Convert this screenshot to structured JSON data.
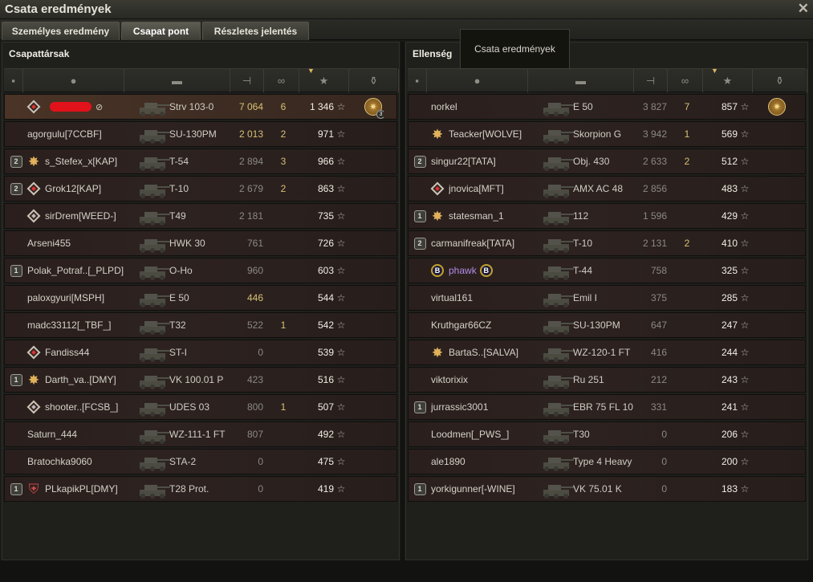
{
  "window": {
    "title": "Csata eredmények",
    "tooltip": "Csata eredmények"
  },
  "tabs": [
    {
      "label": "Személyes eredmény",
      "active": false
    },
    {
      "label": "Csapat pont",
      "active": true
    },
    {
      "label": "Részletes jelentés",
      "active": false
    }
  ],
  "columns": [
    "rank-icon",
    "player-icon",
    "vehicle-icon",
    "damage-icon",
    "frags-icon",
    "xp-icon",
    "achievement-icon"
  ],
  "allies": {
    "title": "Csapattársak",
    "rows": [
      {
        "badge": "",
        "mark": "diamond",
        "player": "",
        "redacted": true,
        "vehicle": "Strv 103-0",
        "damage": "7 064",
        "frags": "6",
        "xp": "1 346",
        "me": true,
        "medal": "3",
        "dmg_hi": true
      },
      {
        "badge": "",
        "mark": "",
        "player": "agorgulu[7CCBF]",
        "vehicle": "SU-130PM",
        "damage": "2 013",
        "frags": "2",
        "xp": "971",
        "dmg_hi": true
      },
      {
        "badge": "2",
        "mark": "sun",
        "player": "s_Stefex_x[KAP]",
        "vehicle": "T-54",
        "damage": "2 894",
        "frags": "3",
        "xp": "966"
      },
      {
        "badge": "2",
        "mark": "diamond",
        "player": "Grok12[KAP]",
        "vehicle": "T-10",
        "damage": "2 679",
        "frags": "2",
        "xp": "863"
      },
      {
        "badge": "",
        "mark": "diamond2",
        "player": "sirDrem[WEED-]",
        "vehicle": "T49",
        "damage": "2 181",
        "frags": "",
        "xp": "735"
      },
      {
        "badge": "",
        "mark": "",
        "player": "Arseni455",
        "vehicle": "HWK 30",
        "damage": "761",
        "frags": "",
        "xp": "726"
      },
      {
        "badge": "1",
        "mark": "",
        "player": "Polak_Potraf..[_PLPD]",
        "vehicle": "O-Ho",
        "damage": "960",
        "frags": "",
        "xp": "603"
      },
      {
        "badge": "",
        "mark": "",
        "player": "paloxgyuri[MSPH]",
        "vehicle": "E 50",
        "damage": "446",
        "frags": "",
        "xp": "544",
        "dmg_hi": true
      },
      {
        "badge": "",
        "mark": "",
        "player": "madc33112[_TBF_]",
        "vehicle": "T32",
        "damage": "522",
        "frags": "1",
        "xp": "542"
      },
      {
        "badge": "",
        "mark": "diamond",
        "player": "Fandiss44",
        "vehicle": "ST-I",
        "damage": "0",
        "frags": "",
        "xp": "539"
      },
      {
        "badge": "1",
        "mark": "sun",
        "player": "Darth_va..[DMY]",
        "vehicle": "VK 100.01 P",
        "damage": "423",
        "frags": "",
        "xp": "516"
      },
      {
        "badge": "",
        "mark": "diamond2",
        "player": "shooter..[FCSB_]",
        "vehicle": "UDES 03",
        "damage": "800",
        "frags": "1",
        "xp": "507"
      },
      {
        "badge": "",
        "mark": "",
        "player": "Saturn_444",
        "vehicle": "WZ-111-1 FT",
        "damage": "807",
        "frags": "",
        "xp": "492"
      },
      {
        "badge": "",
        "mark": "",
        "player": "Bratochka9060",
        "vehicle": "STA-2",
        "damage": "0",
        "frags": "",
        "xp": "475"
      },
      {
        "badge": "1",
        "mark": "shield",
        "player": "PLkapikPL[DMY]",
        "vehicle": "T28 Prot.",
        "damage": "0",
        "frags": "",
        "xp": "419"
      }
    ]
  },
  "enemies": {
    "title": "Ellenség",
    "rows": [
      {
        "badge": "",
        "mark": "",
        "player": "norkel",
        "vehicle": "E 50",
        "damage": "3 827",
        "frags": "7",
        "xp": "857",
        "medal": ""
      },
      {
        "badge": "",
        "mark": "sun",
        "player": "Teacker[WOLVE]",
        "vehicle": "Skorpion G",
        "damage": "3 942",
        "frags": "1",
        "xp": "569"
      },
      {
        "badge": "2",
        "mark": "",
        "player": "singur22[TATA]",
        "vehicle": "Obj. 430",
        "damage": "2 633",
        "frags": "2",
        "xp": "512"
      },
      {
        "badge": "",
        "mark": "diamond",
        "player": "jnovica[MFT]",
        "vehicle": "AMX AC 48",
        "damage": "2 856",
        "frags": "",
        "xp": "483"
      },
      {
        "badge": "1",
        "mark": "sun",
        "player": "statesman_1",
        "vehicle": "112",
        "damage": "1 596",
        "frags": "",
        "xp": "429"
      },
      {
        "badge": "2",
        "mark": "",
        "player": "carmanifreak[TATA]",
        "vehicle": "T-10",
        "damage": "2 131",
        "frags": "2",
        "xp": "410"
      },
      {
        "badge": "",
        "mark": "b",
        "player": "phawk",
        "vehicle": "T-44",
        "damage": "758",
        "frags": "",
        "xp": "325",
        "purple": true
      },
      {
        "badge": "",
        "mark": "",
        "player": "virtual161",
        "vehicle": "Emil I",
        "damage": "375",
        "frags": "",
        "xp": "285"
      },
      {
        "badge": "",
        "mark": "",
        "player": "Kruthgar66CZ",
        "vehicle": "SU-130PM",
        "damage": "647",
        "frags": "",
        "xp": "247"
      },
      {
        "badge": "",
        "mark": "sun",
        "player": "BartaS..[SALVA]",
        "vehicle": "WZ-120-1 FT",
        "damage": "416",
        "frags": "",
        "xp": "244"
      },
      {
        "badge": "",
        "mark": "",
        "player": "viktorixix",
        "vehicle": "Ru 251",
        "damage": "212",
        "frags": "",
        "xp": "243"
      },
      {
        "badge": "1",
        "mark": "",
        "player": "jurrassic3001",
        "vehicle": "EBR 75 FL 10",
        "damage": "331",
        "frags": "",
        "xp": "241"
      },
      {
        "badge": "",
        "mark": "",
        "player": "Loodmen[_PWS_]",
        "vehicle": "T30",
        "damage": "0",
        "frags": "",
        "xp": "206"
      },
      {
        "badge": "",
        "mark": "",
        "player": "ale1890",
        "vehicle": "Type 4 Heavy",
        "damage": "0",
        "frags": "",
        "xp": "200"
      },
      {
        "badge": "1",
        "mark": "",
        "player": "yorkigunner[-WINE]",
        "vehicle": "VK 75.01 K",
        "damage": "0",
        "frags": "",
        "xp": "183"
      }
    ]
  },
  "colors": {
    "accent": "#d8c074",
    "redacted": "#e2121a",
    "clan_purple": "#b48be8"
  }
}
